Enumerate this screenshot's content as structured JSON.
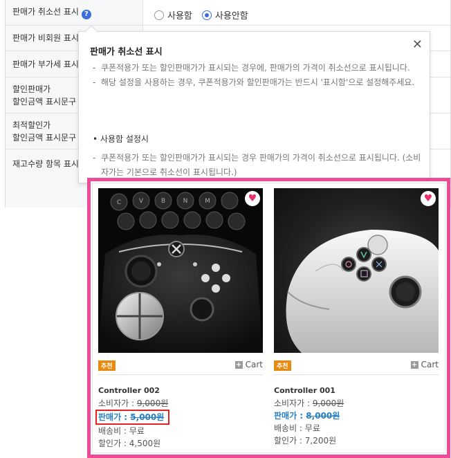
{
  "settings": {
    "rows": [
      {
        "label": "판매가 취소선 표시"
      },
      {
        "label": "판매가 비회원 표시"
      },
      {
        "label": "판매가 부가세 표시"
      },
      {
        "label": "할인판매가",
        "label2": "할인금액 표시문구"
      },
      {
        "label": "최적할인가",
        "label2": "할인금액 표시문구"
      },
      {
        "label": "재고수량 항목 표시"
      }
    ],
    "help_icon": "?",
    "options": [
      {
        "label": "사용함",
        "checked": false
      },
      {
        "label": "사용안함",
        "checked": true
      }
    ]
  },
  "popup": {
    "title": "판매가 취소선 표시",
    "close": "✕",
    "bullets": [
      "쿠폰적용가 또는 할인판매가가 표시되는 경우에, 판매가의 가격이 취소선으로 표시됩니다.",
      "해당 설정을 사용하는 경우, 쿠폰적용가와 할인판매가는 반드시 '표시함'으로 설정해주세요."
    ],
    "subtitle": "사용함 설정시",
    "bullets2": [
      "쿠폰적용가 또는 할인판매가가 표시되는 경우 판매가의 가격이 취소선으로 표시됩니다. (소비자가는 기본으로 취소선이 표시됩니다.)"
    ]
  },
  "products": [
    {
      "badge": "추천",
      "cart": "Cart",
      "name": "Controller 002",
      "consumer_label": "소비자가 : ",
      "consumer_price": "9,000원",
      "sale_label": "판매가 : ",
      "sale_price": "5,000원",
      "shipping": "배송비 : 무료",
      "discount": "할인가 : 4,500원",
      "image": "keyboard-xbox-controller-photo"
    },
    {
      "badge": "추천",
      "cart": "Cart",
      "name": "Controller 001",
      "consumer_label": "소비자가 : ",
      "consumer_price": "9,000원",
      "sale_label": "판매가 : ",
      "sale_price": "8,000원",
      "shipping": "배송비 : 무료",
      "discount": "할인가 : 7,200원",
      "image": "white-ps-controller-photo"
    }
  ],
  "colors": {
    "accent": "#3b6ed8",
    "preview_border": "#ee4a96",
    "highlight": "#e52222",
    "sale_text": "#2a7fc1",
    "badge": "#e88a10"
  }
}
